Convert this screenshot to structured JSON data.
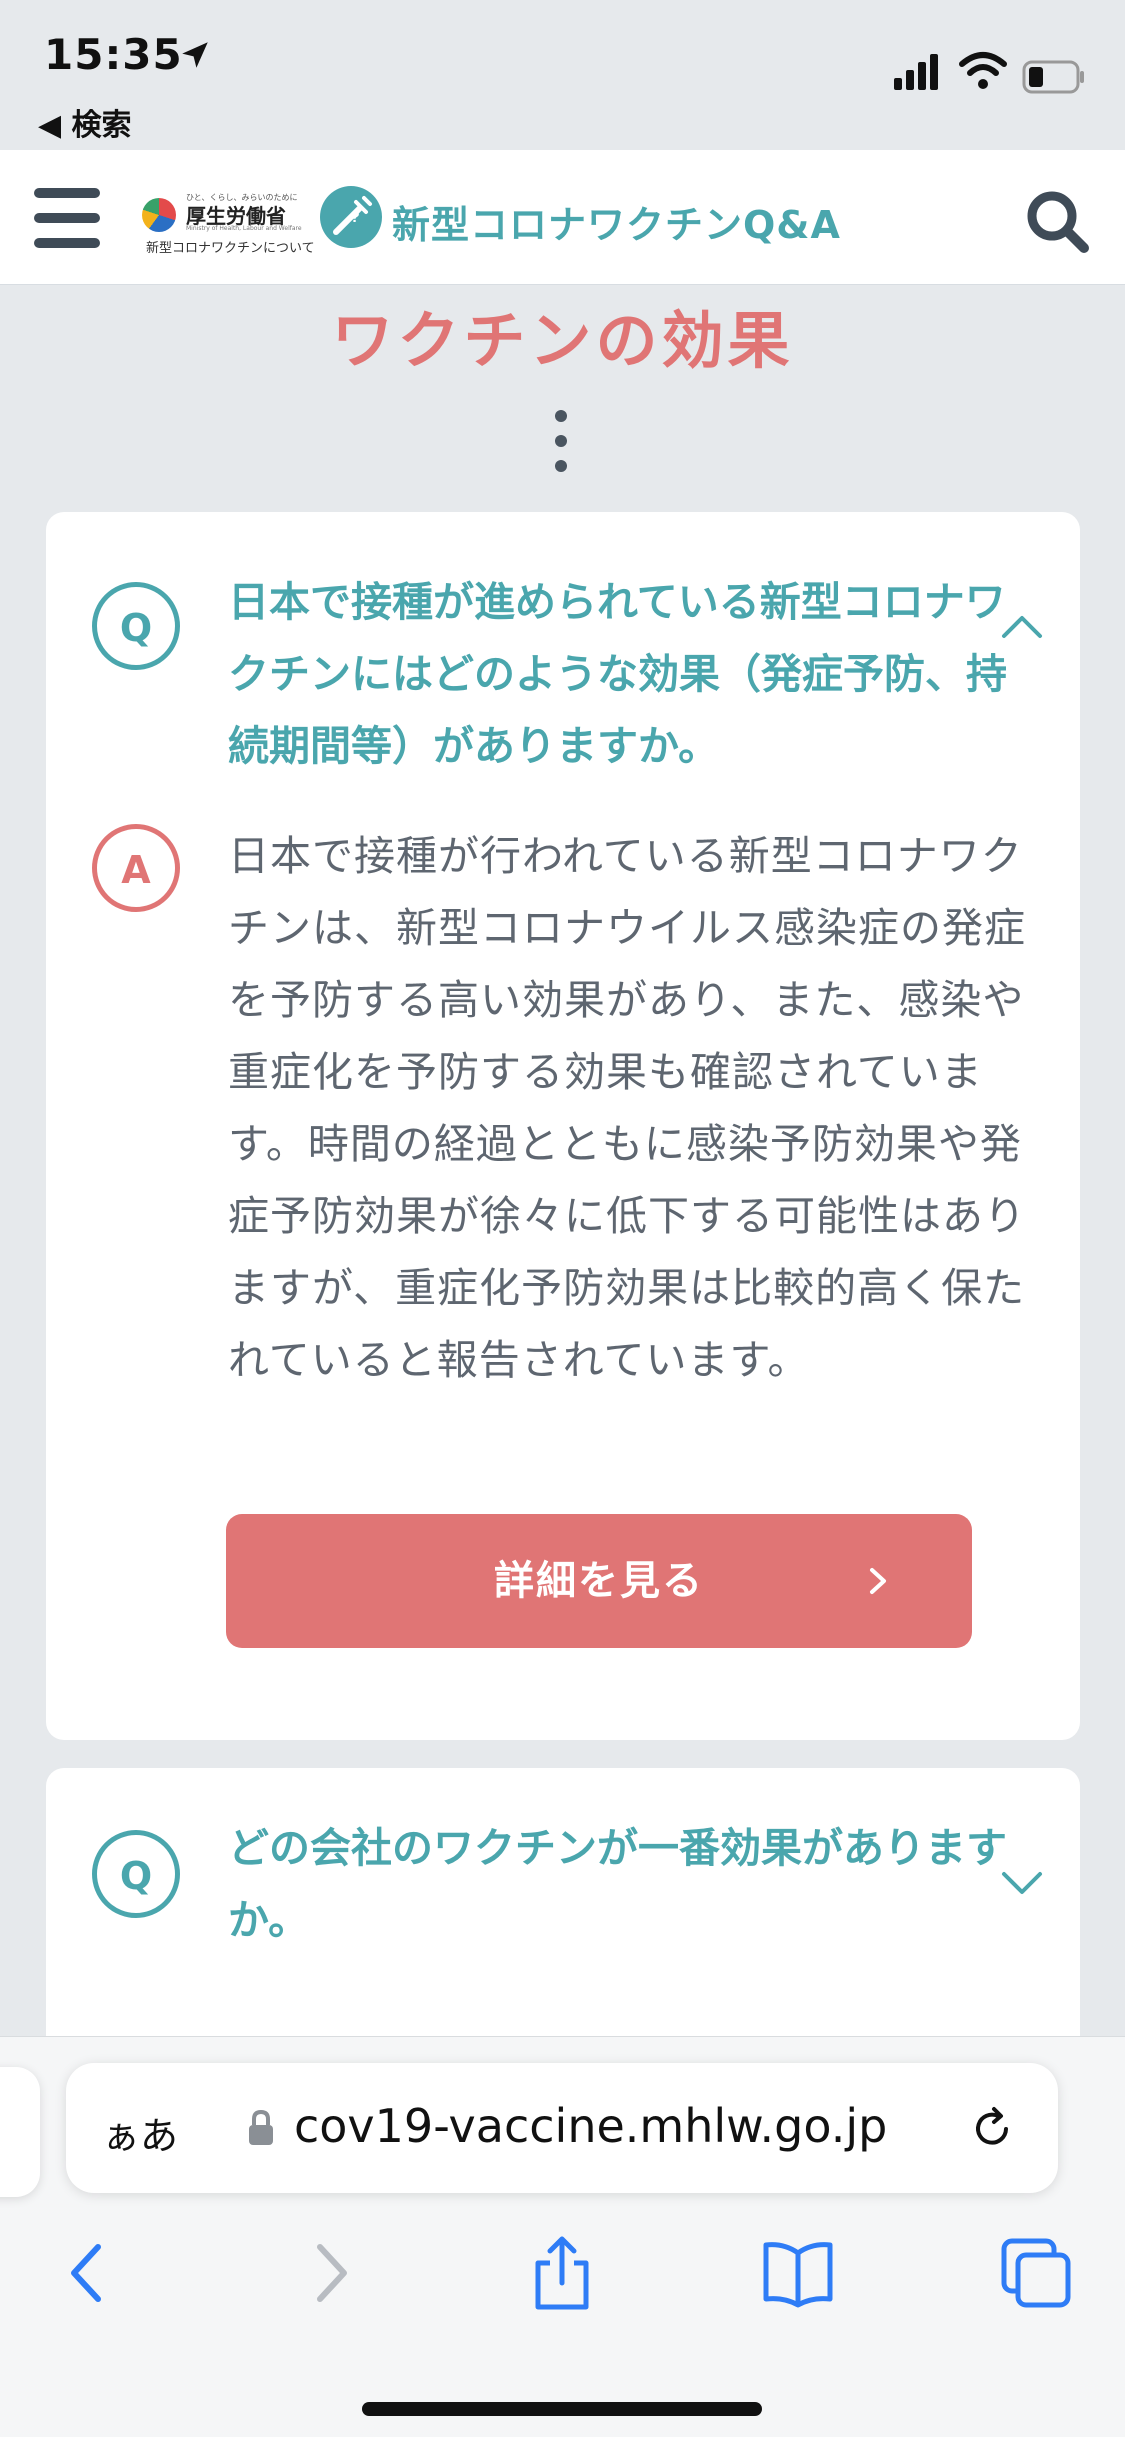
{
  "status_bar": {
    "time": "15:35",
    "back_app": "◀ 検索",
    "icons": [
      "location-arrow-icon",
      "signal-icon",
      "wifi-icon",
      "battery-icon"
    ]
  },
  "header": {
    "menu_icon": "hamburger-menu-icon",
    "ministry": {
      "tagline": "ひと、くらし、みらいのために",
      "name": "厚生労働省",
      "english": "Ministry of Health, Labour and Welfare",
      "sub": "新型コロナワクチンについて"
    },
    "site_title": "新型コロナワクチンQ&A",
    "search_icon": "search-icon"
  },
  "page": {
    "title": "ワクチンの効果"
  },
  "qa_items": [
    {
      "q_badge": "Q",
      "question": "日本で接種が進められている新型コロナワクチンにはどのような効果（発症予防、持続期間等）がありますか。",
      "a_badge": "A",
      "answer": "日本で接種が行われている新型コロナワクチンは、新型コロナウイルス感染症の発症を予防する高い効果があり、また、感染や重症化を予防する効果も確認されています。時間の経過とともに感染予防効果や発症予防効果が徐々に低下する可能性はありますが、重症化予防効果は比較的高く保たれていると報告されています。",
      "button_label": "詳細を見る",
      "expanded": true
    },
    {
      "q_badge": "Q",
      "question": "どの会社のワクチンが一番効果がありますか。",
      "expanded": false
    }
  ],
  "browser": {
    "text_size_label": "ぁあ",
    "url": "cov19-vaccine.mhlw.go.jp",
    "toolbar": [
      "back-icon",
      "forward-icon",
      "share-icon",
      "bookmarks-icon",
      "tabs-icon"
    ]
  },
  "colors": {
    "teal": "#4aa6ad",
    "coral": "#e07575",
    "text": "#5e6670",
    "background": "#e6e9ec"
  }
}
